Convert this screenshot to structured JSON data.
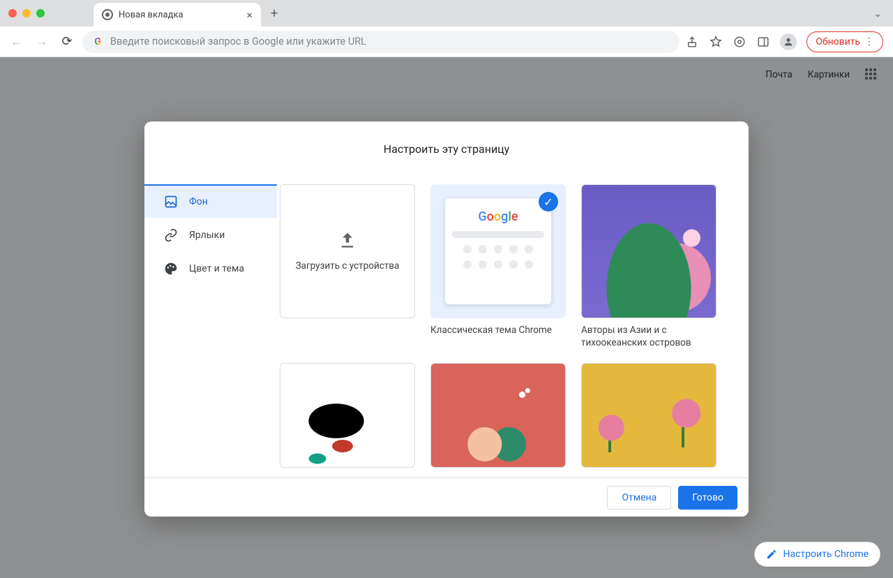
{
  "window": {
    "tab_title": "Новая вкладка",
    "omnibox_placeholder": "Введите поисковый запрос в Google или укажите URL",
    "update_label": "Обновить"
  },
  "ntp": {
    "link_mail": "Почта",
    "link_images": "Картинки",
    "customize_button": "Настроить Chrome"
  },
  "dialog": {
    "title": "Настроить эту страницу",
    "sidebar": {
      "background": "Фон",
      "shortcuts": "Ярлыки",
      "color_theme": "Цвет и тема"
    },
    "upload_label": "Загрузить с устройства",
    "themes": {
      "classic": "Классическая тема Chrome",
      "asian_pacific": "Авторы из Азии и с тихоокеанских островов"
    },
    "footer": {
      "cancel": "Отмена",
      "done": "Готово"
    }
  }
}
